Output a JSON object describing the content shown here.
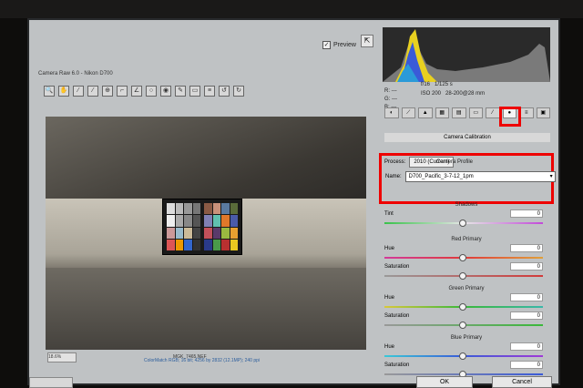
{
  "window": {
    "title": "Camera Raw 6.0 - Nikon D700"
  },
  "preview": {
    "label": "Preview",
    "checked": "✓"
  },
  "toolbar": {
    "tools": [
      "zoom",
      "hand",
      "white-balance",
      "color-sampler",
      "target-adjust",
      "crop",
      "straighten",
      "spot",
      "red-eye",
      "brush",
      "gradient",
      "prefs",
      "rotate-ccw",
      "rotate-cw"
    ]
  },
  "image": {
    "zoom": "18.6%",
    "filename": "MGK_7465.NEF"
  },
  "workflow": {
    "text": "ColorMatch RGB; 16 bit; 4256 by 2832 (12.1MP); 240 ppi"
  },
  "histogram": {
    "bg": "#2a2a2a"
  },
  "readout": {
    "r": "R:  ---",
    "g": "G:  ---",
    "b": "B:  ---",
    "fstop": "f/16",
    "shutter": "1/125 s",
    "iso": "ISO 200",
    "lens": "28-200@28 mm"
  },
  "panel": {
    "section": "Camera Calibration",
    "process_label": "Process:",
    "process_value": "2010 (Current)",
    "profile_title": "Camera Profile",
    "name_label": "Name:",
    "name_value": "D700_Pacific_3-7-12_1pm"
  },
  "sliders": {
    "shadows": {
      "title": "Shadows",
      "tint_label": "Tint",
      "tint_value": "0"
    },
    "red": {
      "title": "Red Primary",
      "hue_label": "Hue",
      "hue_value": "0",
      "sat_label": "Saturation",
      "sat_value": "0"
    },
    "green": {
      "title": "Green Primary",
      "hue_label": "Hue",
      "hue_value": "0",
      "sat_label": "Saturation",
      "sat_value": "0"
    },
    "blue": {
      "title": "Blue Primary",
      "hue_label": "Hue",
      "hue_value": "0",
      "sat_label": "Saturation",
      "sat_value": "0"
    }
  },
  "buttons": {
    "ok": "OK",
    "cancel": "Cancel"
  },
  "colors": {
    "highlight": "#e00000",
    "link": "#2b5d9c"
  }
}
